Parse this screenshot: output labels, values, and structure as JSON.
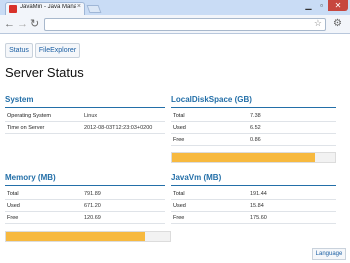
{
  "browser": {
    "tab_title": "JavaMin - Java Managem",
    "tab_close": "×",
    "back": "←",
    "forward": "→",
    "reload": "↻",
    "star": "☆",
    "menu": "🔧"
  },
  "nav": {
    "status_label": "Status",
    "file_label": "FileExplorer"
  },
  "page_title": "Server Status",
  "system": {
    "title": "System",
    "rows": [
      {
        "key": "Operating System",
        "value": "Linux"
      },
      {
        "key": "Time on Server",
        "value": "2012-08-03T12:23:03+0200"
      }
    ]
  },
  "disk": {
    "title": "LocalDiskSpace (GB)",
    "rows": [
      {
        "key": "Total",
        "value": "7.38"
      },
      {
        "key": "Used",
        "value": "6.52"
      },
      {
        "key": "Free",
        "value": "0.86"
      }
    ],
    "usage_fraction": 0.88
  },
  "memory": {
    "title": "Memory (MB)",
    "rows": [
      {
        "key": "Total",
        "value": "791.89"
      },
      {
        "key": "Used",
        "value": "671.20"
      },
      {
        "key": "Free",
        "value": "120.69"
      }
    ],
    "usage_fraction": 0.85
  },
  "javavm": {
    "title": "JavaVm (MB)",
    "rows": [
      {
        "key": "Total",
        "value": "191.44"
      },
      {
        "key": "Used",
        "value": "15.84"
      },
      {
        "key": "Free",
        "value": "175.60"
      }
    ]
  },
  "footer": {
    "language_label": "Language"
  },
  "colors": {
    "accent": "#236fa8",
    "bar_fill": "#f7b93f"
  }
}
